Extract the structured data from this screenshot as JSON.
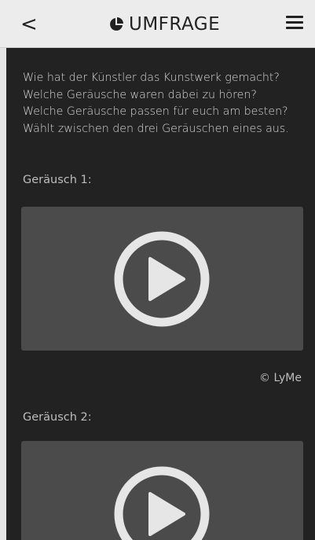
{
  "header": {
    "back_label": "<",
    "title": "UMFRAGE",
    "title_icon": "pie-chart-icon",
    "menu_icon": "hamburger-menu-icon"
  },
  "question": {
    "lines": [
      "Wie hat der Künstler das Kunstwerk gemacht?",
      "Welche Geräusche waren dabei zu hören?",
      "Welche Geräusche passen für euch am besten?",
      "Wählt zwischen den drei Geräuschen eines aus."
    ]
  },
  "sounds": [
    {
      "label": "Geräusch 1:",
      "play_icon": "play-circle-icon",
      "credit": "© LyMe"
    },
    {
      "label": "Geräusch 2:",
      "play_icon": "play-circle-icon"
    }
  ],
  "colors": {
    "header_bg": "#ececec",
    "content_bg": "#222222",
    "player_bg": "#4b4b4b",
    "icon": "#e6e6e6"
  }
}
